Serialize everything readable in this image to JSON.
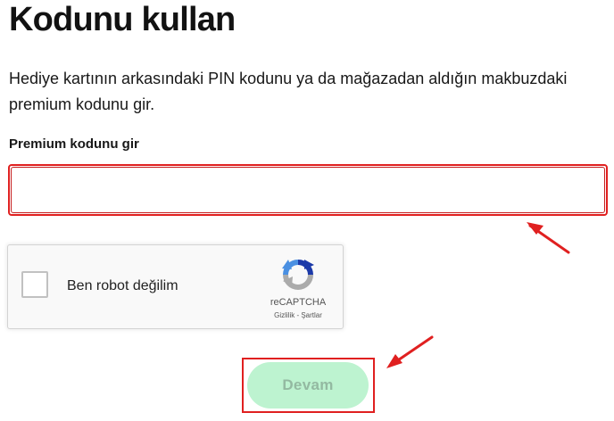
{
  "page": {
    "title": "Kodunu kullan",
    "description": "Hediye kartının arkasındaki PIN kodunu ya da mağazadan aldığın makbuzdaki premium kodunu gir."
  },
  "form": {
    "code_label": "Premium kodunu gir",
    "code_value": "",
    "code_placeholder": ""
  },
  "recaptcha": {
    "label": "Ben robot değilim",
    "brand": "reCAPTCHA",
    "privacy_link": "Gizlilik",
    "separator": " - ",
    "terms_link": "Şartlar",
    "checked": false
  },
  "actions": {
    "continue_label": "Devam",
    "continue_enabled": false
  },
  "colors": {
    "annotation_red": "#e02020",
    "button_bg_disabled": "#bdf3d0",
    "button_text_disabled": "#93b9a1",
    "recaptcha_blue": "#1c3aa9",
    "recaptcha_lightblue": "#4a90e2",
    "recaptcha_gray": "#ababab"
  },
  "icons": {
    "recaptcha": "recaptcha-logo-icon",
    "annotation": "arrow-annotation-icon"
  }
}
